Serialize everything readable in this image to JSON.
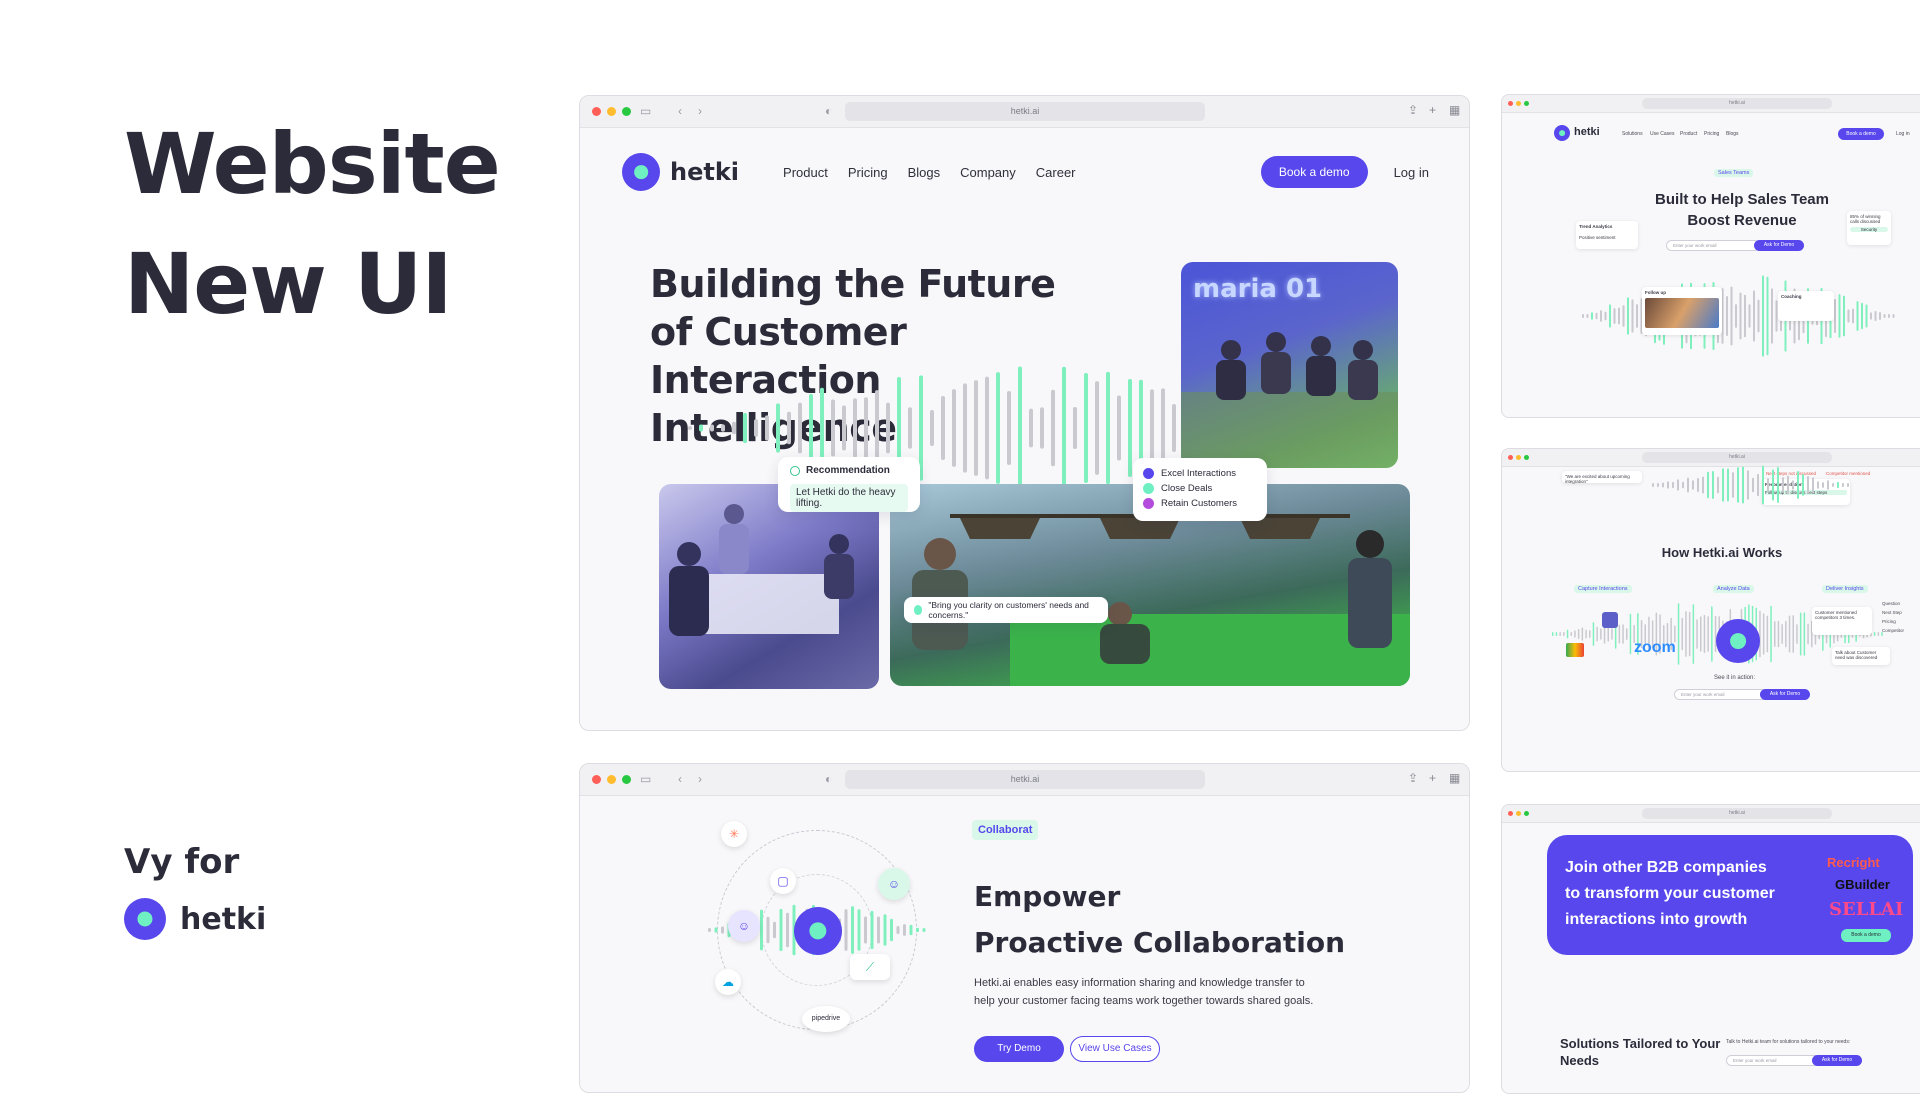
{
  "presentation": {
    "title_line1": "Website",
    "title_line2": "New UI",
    "vy_for": "Vy for",
    "brand": "hetki"
  },
  "colors": {
    "accent": "#5747ec",
    "mint": "#6ef0c2",
    "purple": "#b34bdc"
  },
  "main_window": {
    "url": "hetki.ai",
    "brand": "hetki",
    "nav": [
      "Product",
      "Pricing",
      "Blogs",
      "Company",
      "Career"
    ],
    "cta": "Book a demo",
    "login": "Log in",
    "hero_title": "Building the Future of Customer Interaction Intelligence",
    "photo_caption": "maria 01",
    "recommendation": {
      "title": "Recommendation",
      "body": "Let Hetki do the heavy lifting."
    },
    "legend": [
      "Excel Interactions",
      "Close Deals",
      "Retain Customers"
    ],
    "quote": "\"Bring you clarity on customers' needs and concerns.\""
  },
  "collab_window": {
    "url": "hetki.ai",
    "tag": "Collaborat",
    "heading_line1": "Empower",
    "heading_line2": "Proactive Collaboration",
    "paragraph": "Hetki.ai enables easy information sharing and knowledge transfer to help your customer facing teams work together towards shared goals.",
    "primary_button": "Try Demo",
    "secondary_button": "View Use Cases",
    "orbit_labels": [
      "pipedrive"
    ]
  },
  "thumb_sales": {
    "url": "hetki.ai",
    "brand": "hetki",
    "nav": [
      "Solutions",
      "Use Cases",
      "Product",
      "Pricing",
      "Blogs"
    ],
    "cta": "Book a demo",
    "login": "Log in",
    "tag": "Sales Teams",
    "heading": "Built to Help Sales Team Boost Revenue",
    "input_placeholder": "Enter your work email",
    "button": "Ask for Demo",
    "card_left_title": "Trend Analytics",
    "card_left_body": "Positive sentiment",
    "card_right_stat": "85% of winning calls discussed",
    "card_right_badge": "Security",
    "card_coaching": "Coaching",
    "card_followup": "Follow up"
  },
  "thumb_how": {
    "url": "hetki.ai",
    "heading": "How Hetki.ai Works",
    "steps": [
      "Capture Interactions",
      "Analyze Data",
      "Deliver Insights"
    ],
    "zoom": "zoom",
    "see_it": "See it in action:",
    "input_placeholder": "Enter your work email",
    "button": "Ask for Demo",
    "top_labels": [
      "Next steps not discussed",
      "Competitor mentioned",
      "Recommendation",
      "Follow up to discuss next steps"
    ],
    "top_quote": "\"We are excited about upcoming integration\"",
    "insight_list": [
      "Question",
      "Next Step",
      "Pricing",
      "Competitor"
    ],
    "insight_text": "Customer mentioned competitors 3 times.",
    "insight_text2": "Talk about Customer need was discovered"
  },
  "thumb_cta": {
    "url": "hetki.ai",
    "banner": "Join other B2B companies to transform your customer interactions into growth",
    "logos": [
      "Recright",
      "GBuilder",
      "SELLAI"
    ],
    "banner_button": "Book a demo",
    "solutions_heading": "Solutions Tailored to Your Needs",
    "talk_text": "Talk to Hetki.ai team for solutions tailored to your needs:",
    "input_placeholder": "Enter your work email",
    "button": "Ask for Demo"
  }
}
